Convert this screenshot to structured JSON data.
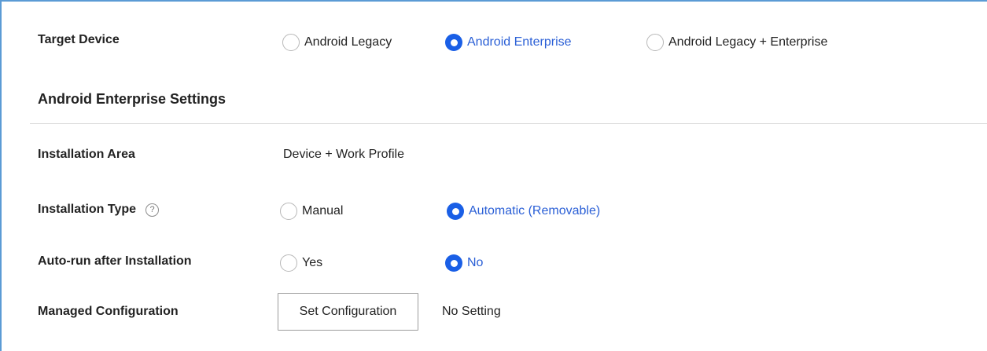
{
  "target_device": {
    "label": "Target Device",
    "options": [
      {
        "label": "Android Legacy",
        "selected": false
      },
      {
        "label": "Android Enterprise",
        "selected": true
      },
      {
        "label": "Android Legacy + Enterprise",
        "selected": false
      }
    ]
  },
  "section_title": "Android Enterprise Settings",
  "installation_area": {
    "label": "Installation Area",
    "value": "Device + Work Profile"
  },
  "installation_type": {
    "label": "Installation Type",
    "help_glyph": "?",
    "options": [
      {
        "label": "Manual",
        "selected": false
      },
      {
        "label": "Automatic (Removable)",
        "selected": true
      }
    ]
  },
  "auto_run": {
    "label": "Auto-run after Installation",
    "options": [
      {
        "label": "Yes",
        "selected": false
      },
      {
        "label": "No",
        "selected": true
      }
    ]
  },
  "managed_configuration": {
    "label": "Managed Configuration",
    "button_label": "Set Configuration",
    "status": "No Setting"
  },
  "colors": {
    "accent": "#1a5fe6",
    "selected_text": "#2a5fd6",
    "panel_border": "#5b9bd5"
  }
}
